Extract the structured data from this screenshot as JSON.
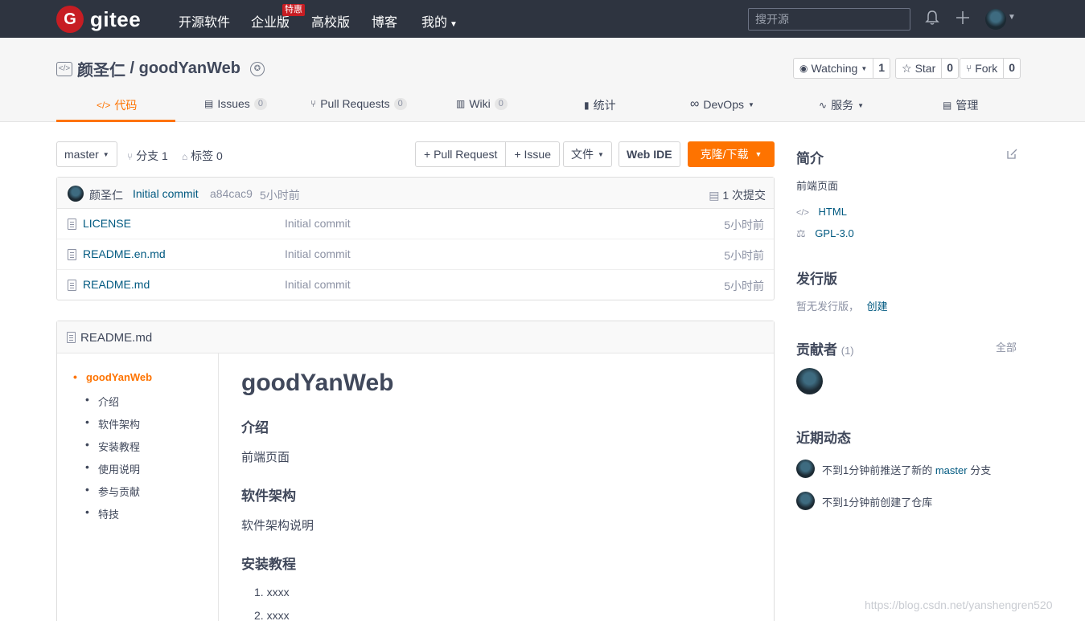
{
  "topnav": {
    "logo_mark": "G",
    "logo_text": "gitee",
    "links": [
      "开源软件",
      "企业版",
      "高校版",
      "博客",
      "我的"
    ],
    "badge": "特惠",
    "search_placeholder": "搜开源",
    "bell_icon": "bell-icon",
    "plus_icon": "plus-icon"
  },
  "project": {
    "owner": "颜圣仁",
    "separator": " / ",
    "name": "goodYanWeb",
    "watch_label": "Watching",
    "watch_count": "1",
    "star_label": "Star",
    "star_count": "0",
    "fork_label": "Fork",
    "fork_count": "0"
  },
  "tabs": [
    {
      "label": "代码"
    },
    {
      "label": "Issues",
      "count": "0"
    },
    {
      "label": "Pull Requests",
      "count": "0"
    },
    {
      "label": "Wiki",
      "count": "0"
    },
    {
      "label": "统计"
    },
    {
      "label": "DevOps"
    },
    {
      "label": "服务"
    },
    {
      "label": "管理"
    }
  ],
  "branchbar": {
    "branch": "master",
    "branches": "分支 1",
    "tags": "标签 0",
    "pull_request": "+ Pull Request",
    "issue": "+ Issue",
    "file": "文件",
    "web_ide": "Web IDE",
    "clone": "克隆/下载"
  },
  "commit": {
    "author": "颜圣仁",
    "message": "Initial commit",
    "hash": "a84cac9",
    "time": "5小时前",
    "count": "1 次提交"
  },
  "files": [
    {
      "name": "LICENSE",
      "msg": "Initial commit",
      "time": "5小时前"
    },
    {
      "name": "README.en.md",
      "msg": "Initial commit",
      "time": "5小时前"
    },
    {
      "name": "README.md",
      "msg": "Initial commit",
      "time": "5小时前"
    }
  ],
  "readme": {
    "filename": "README.md",
    "toc": [
      "goodYanWeb",
      "介绍",
      "软件架构",
      "安装教程",
      "使用说明",
      "参与贡献",
      "特技"
    ],
    "h1": "goodYanWeb",
    "h2_intro": "介绍",
    "p_intro": "前端页面",
    "h2_arch": "软件架构",
    "p_arch": "软件架构说明",
    "h2_install": "安装教程",
    "li1": "1.  xxxx",
    "li2": "2.  xxxx"
  },
  "sidebar": {
    "intro_title": "简介",
    "intro_desc": "前端页面",
    "lang": "HTML",
    "license": "GPL-3.0",
    "release_title": "发行版",
    "release_text": "暂无发行版，",
    "release_create": "创建",
    "contrib_title": "贡献者",
    "contrib_count": "(1)",
    "contrib_all": "全部",
    "activity_title": "近期动态",
    "activity1_pre": "不到1分钟前推送了新的 ",
    "activity1_branch": "master",
    "activity1_post": " 分支",
    "activity2": "不到1分钟前创建了仓库"
  },
  "watermark": "https://blog.csdn.net/yanshengren520",
  "colors": {
    "accent": "#fe7300",
    "nav_bg": "#2e3440",
    "brand": "#c71d23",
    "link": "#005980"
  }
}
